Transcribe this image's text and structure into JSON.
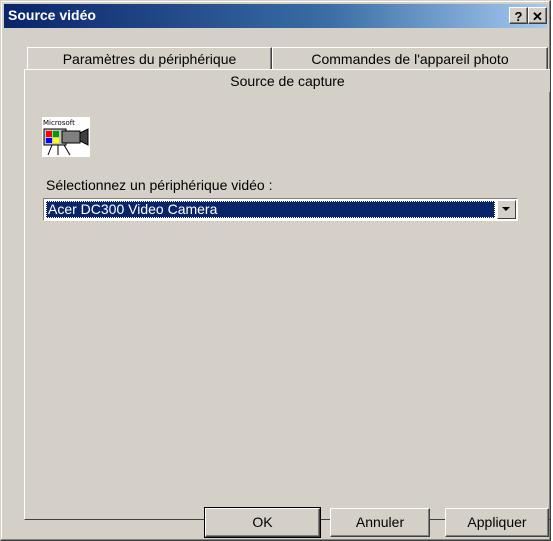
{
  "window": {
    "title": "Source vidéo",
    "help_label": "?",
    "close_label": "✕"
  },
  "tabs": [
    {
      "label": "Paramètres du périphérique"
    },
    {
      "label": "Commandes de l'appareil photo"
    },
    {
      "label": "Source de capture"
    }
  ],
  "capture": {
    "icon": "microsoft-video-camera-icon",
    "icon_text": "Microsoft",
    "select_label": "Sélectionnez un périphérique vidéo :",
    "selected_device": "Acer DC300 Video Camera"
  },
  "buttons": {
    "ok": "OK",
    "cancel": "Annuler",
    "apply": "Appliquer"
  },
  "colors": {
    "titlebar": "#0a246a",
    "selection": "#0a246a",
    "face": "#d4d0c8"
  }
}
